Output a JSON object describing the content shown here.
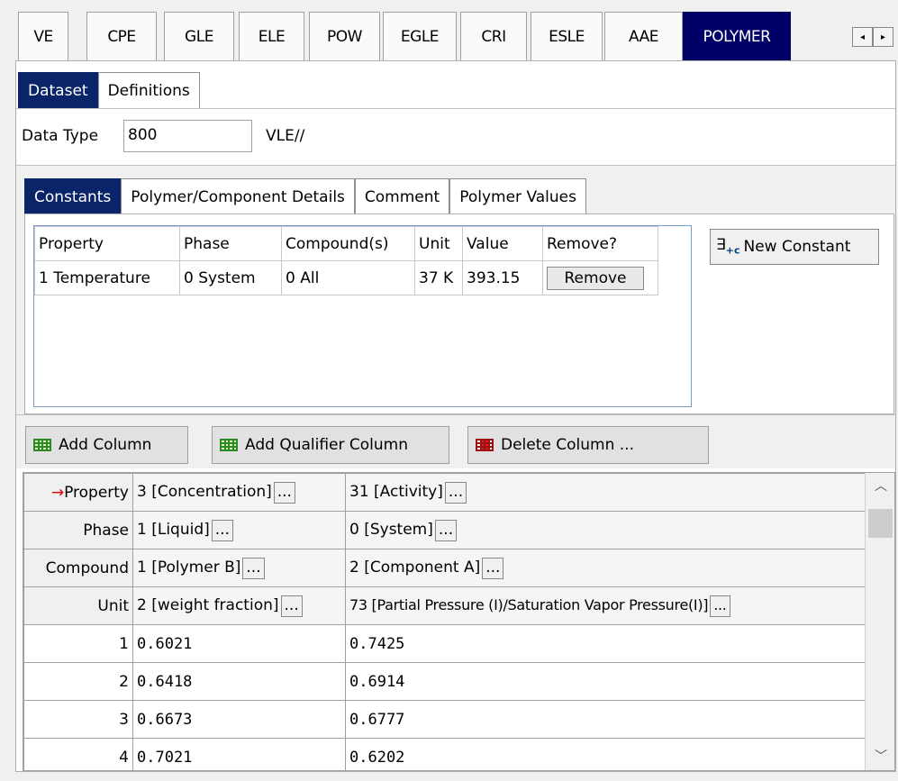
{
  "top_tabs": [
    "VE",
    "CPE",
    "GLE",
    "ELE",
    "POW",
    "EGLE",
    "CRI",
    "ESLE",
    "AAE",
    "POLYMER"
  ],
  "active_top_tab": "POLYMER",
  "scroll_left": "◂",
  "scroll_right": "▸",
  "dataset_tabs": {
    "dataset": "Dataset",
    "definitions": "Definitions"
  },
  "data_type": {
    "label": "Data Type",
    "value": "800",
    "suffix": "VLE//"
  },
  "constant_tabs": [
    "Constants",
    "Polymer/Component Details",
    "Comment",
    "Polymer Values"
  ],
  "constants_table": {
    "headers": [
      "Property",
      "Phase",
      "Compound(s)",
      "Unit",
      "Value",
      "Remove?"
    ],
    "rows": [
      {
        "property": "1 Temperature",
        "phase": "0 System",
        "compound": "0 All",
        "unit": "37 K",
        "value": "393.15",
        "remove": "Remove"
      }
    ]
  },
  "new_constant": {
    "icon": "new-constant-icon",
    "label": "New Constant"
  },
  "column_buttons": {
    "add_column": "Add Column",
    "add_qualifier": "Add Qualifier Column",
    "delete_column": "Delete Column ..."
  },
  "grid": {
    "header_labels": {
      "property": "Property",
      "phase": "Phase",
      "compound": "Compound",
      "unit": "Unit"
    },
    "col1": {
      "property": "3 [Concentration]",
      "phase": "1 [Liquid]",
      "compound": "1 [Polymer B]",
      "unit": "2 [weight fraction]"
    },
    "col2": {
      "property": "31 [Activity]",
      "phase": "0 [System]",
      "compound": "2 [Component A]",
      "unit": "73 [Partial Pressure (I)/Saturation Vapor Pressure(I)]"
    },
    "ellipsis": "...",
    "rows": [
      {
        "n": "1",
        "c1": "0.6021",
        "c2": "0.7425"
      },
      {
        "n": "2",
        "c1": "0.6418",
        "c2": "0.6914"
      },
      {
        "n": "3",
        "c1": "0.6673",
        "c2": "0.6777"
      },
      {
        "n": "4",
        "c1": "0.7021",
        "c2": "0.6202"
      }
    ]
  },
  "colors": {
    "active_tab": "#000066",
    "arrow": "#e00000"
  }
}
